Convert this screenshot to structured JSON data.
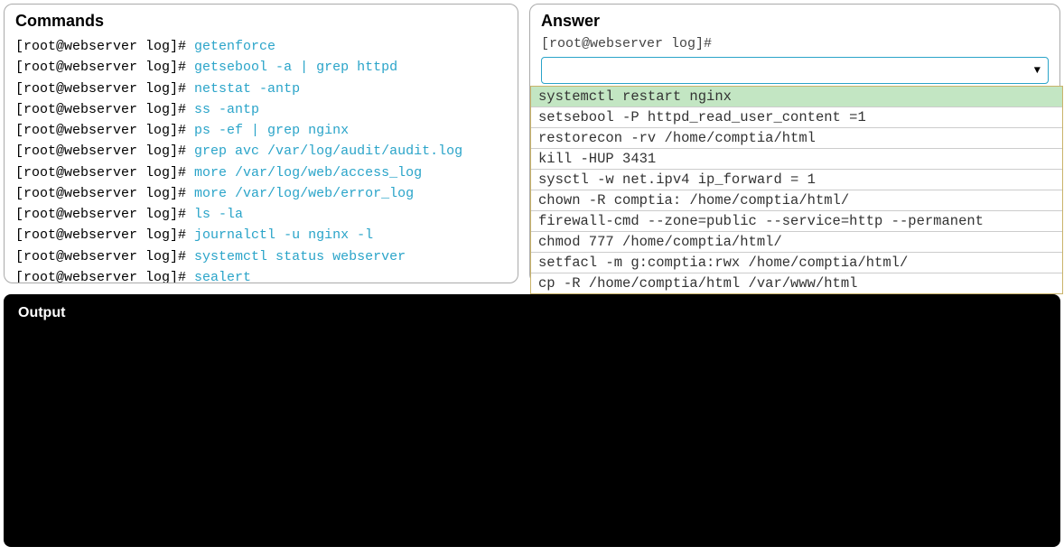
{
  "commands_panel": {
    "title": "Commands",
    "prompt": "[root@webserver log]# ",
    "lines": [
      "getenforce",
      "getsebool -a | grep httpd",
      "netstat -antp",
      "ss -antp",
      "ps -ef | grep nginx",
      "grep avc /var/log/audit/audit.log",
      "more /var/log/web/access_log",
      "more /var/log/web/error_log",
      "ls -la",
      "journalctl -u nginx -l",
      "systemctl status webserver",
      "sealert"
    ]
  },
  "answer_panel": {
    "title": "Answer",
    "prompt": "[root@webserver log]#",
    "selected": "",
    "options": [
      {
        "label": "systemctl restart nginx",
        "highlight": true
      },
      {
        "label": "setsebool -P httpd_read_user_content =1",
        "highlight": false
      },
      {
        "label": "restorecon -rv /home/comptia/html",
        "highlight": false
      },
      {
        "label": "kill -HUP 3431",
        "highlight": false
      },
      {
        "label": "sysctl -w net.ipv4 ip_forward = 1",
        "highlight": false
      },
      {
        "label": "chown -R comptia: /home/comptia/html/",
        "highlight": false
      },
      {
        "label": "firewall-cmd --zone=public --service=http --permanent",
        "highlight": false
      },
      {
        "label": "chmod 777 /home/comptia/html/",
        "highlight": false
      },
      {
        "label": "setfacl -m g:comptia:rwx /home/comptia/html/",
        "highlight": false
      },
      {
        "label": "cp -R /home/comptia/html /var/www/html",
        "highlight": false
      }
    ]
  },
  "output_panel": {
    "title": "Output"
  }
}
